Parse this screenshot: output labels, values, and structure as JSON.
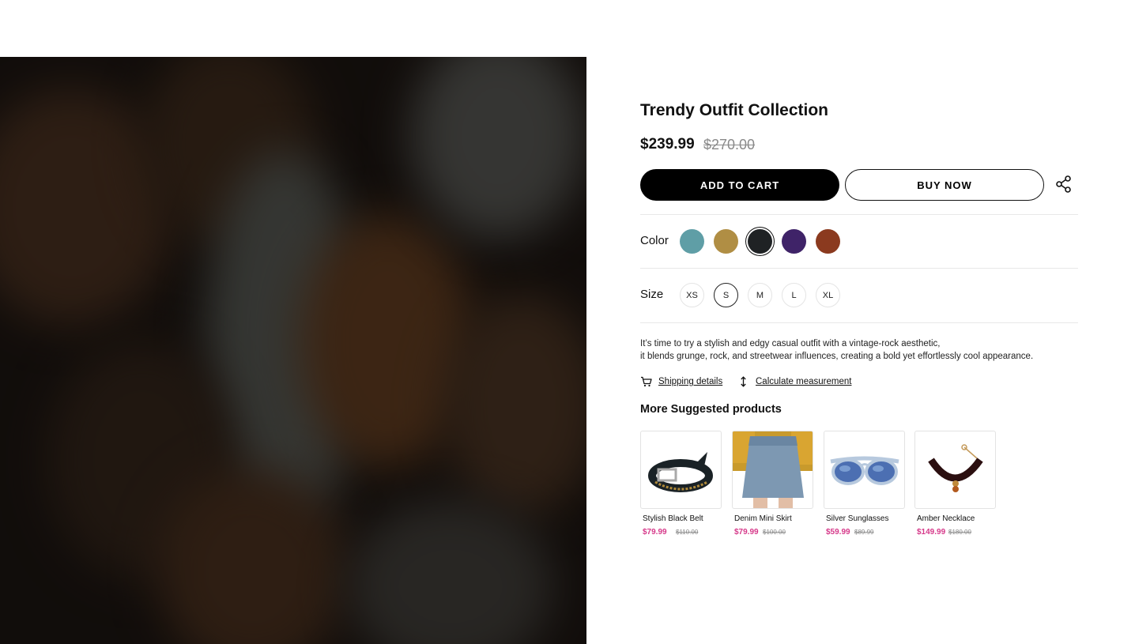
{
  "product": {
    "title": "Trendy Outfit Collection",
    "price": "$239.99",
    "old_price": "$270.00",
    "add_to_cart_label": "ADD TO CART",
    "buy_now_label": "BUY NOW",
    "share_icon": "share-icon"
  },
  "color": {
    "label": "Color",
    "options": [
      {
        "name": "teal",
        "hex": "#5f9ea6"
      },
      {
        "name": "mustard",
        "hex": "#b08e44"
      },
      {
        "name": "black",
        "hex": "#1f2224",
        "selected": true
      },
      {
        "name": "purple",
        "hex": "#3f2368"
      },
      {
        "name": "rust",
        "hex": "#8b3a1f"
      }
    ]
  },
  "size": {
    "label": "Size",
    "options": [
      "XS",
      "S",
      "M",
      "L",
      "XL"
    ],
    "selected": "S"
  },
  "description": {
    "line1": "It’s time to try a stylish and edgy casual outfit with a vintage-rock aesthetic,",
    "line2": "it blends grunge, rock, and streetwear influences, creating a bold yet effortlessly cool appearance."
  },
  "links": {
    "shipping": "Shipping details",
    "shipping_icon": "cart-icon",
    "measurement": "Calculate measurement",
    "measurement_icon": "vertical-arrows-icon"
  },
  "suggested": {
    "title": "More Suggested products",
    "items": [
      {
        "name": "Stylish Black Belt",
        "price": "$79.99",
        "old_price": "$110.00",
        "image": "black-belt"
      },
      {
        "name": "Denim Mini Skirt",
        "price": "$79.99",
        "old_price": "$100.00",
        "image": "denim-skirt"
      },
      {
        "name": "Silver Sunglasses",
        "price": "$59.99",
        "old_price": "$89.99",
        "image": "sunglasses"
      },
      {
        "name": "Amber Necklace",
        "price": "$149.99",
        "old_price": "$180.00",
        "image": "choker-necklace"
      }
    ]
  },
  "colors": {
    "price_accent": "#d6398a",
    "primary_button": "#000000"
  }
}
